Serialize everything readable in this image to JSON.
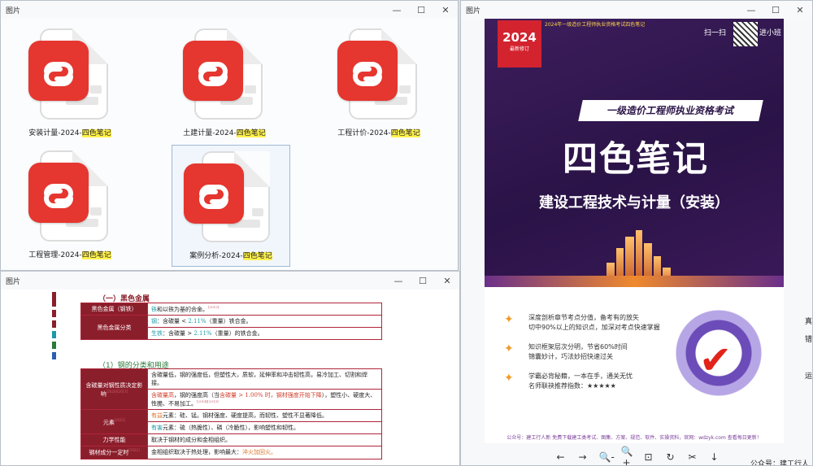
{
  "windows": [
    {
      "title": "图片",
      "controls": [
        "—",
        "☐",
        "✕"
      ]
    },
    {
      "title": "图片",
      "controls": [
        "—",
        "☐",
        "✕"
      ]
    },
    {
      "title": "图片",
      "controls": [
        "—",
        "☐",
        "✕"
      ]
    }
  ],
  "files": [
    {
      "base": "安装计量-2024-",
      "tag": "四色笔记"
    },
    {
      "base": "土建计量-2024-",
      "tag": "四色笔记"
    },
    {
      "base": "工程计价-2024-",
      "tag": "四色笔记"
    },
    {
      "base": "工程管理-2024-",
      "tag": "四色笔记"
    },
    {
      "base": "案例分析-2024-",
      "tag": "四色笔记",
      "selected": true
    }
  ],
  "doc": {
    "sec1": "（一）黑色金属",
    "sec2": "（1）钢的分类和用途",
    "rows": {
      "r1h": "黑色金属（钢铁）",
      "r1a": "铁",
      "r1b": "和以铁为基的合金。",
      "r1s": "[2015]",
      "r2h": "黑色金属分类",
      "r2a1": "钢",
      "r2b1": "：含碳量 < ",
      "r2c1": "2.11%",
      "r2d1": "（重量）铁合金。",
      "r2a2": "生铁",
      "r2b2": "：含碳量 > ",
      "r2c2": "2.11%",
      "r2d2": "（重量）的铁合金。",
      "r3h": "含碳量对钢性质决定影响",
      "r3s": "[2020][2017]",
      "r3a": "含碳量低，钢的强度低，但塑性大，质软，延伸率和冲击韧性高，易冷加工、切割和焊接。",
      "r3b1": "含碳量高",
      "r3b2": "，钢的强度高（当",
      "r3b3": "含碳量 > 1.00% 时，钢材强度开始下降",
      "r3b4": "），塑性小、硬度大、性脆、不易加工。",
      "r3bs": "[2014][2013]",
      "r4h": "元素",
      "r4s": "[2021]",
      "r4a1": "有益",
      "r4a2": "元素：硅、锰。钢材强度、硬度提高，而韧性、塑性不显著降低。",
      "r4b1": "有害",
      "r4b2": "元素：硫（热脆性）、磷（冷脆性），影响塑性和韧性。",
      "r5h": "力学性能",
      "r5a": "取决于钢材的成分和金相组织。",
      "r6h": "钢材成分一定时",
      "r6s": "[2022]",
      "r6a": "金相组织取决于热处理，影响最大：",
      "r6b": "淬火加回火。"
    }
  },
  "cover": {
    "topline": "2024年一级造价工程师执业资格考试四色笔记",
    "year": "2024",
    "edition": "最新修订",
    "scan": "扫一扫",
    "scan2": "进小班",
    "banner": "一级造价工程师执业资格考试",
    "title": "四色笔记",
    "subtitle": "建设工程技术与计量（安装）",
    "f1a": "深度剖析章节考点分值，备考有的放矢",
    "f1b": "切中90%以上的知识点，加深对考点快速掌握",
    "f2a": "知识框架层次分明，节省60%时间",
    "f2b": "锦囊妙计，巧法妙招快速过关",
    "f3a": "学霸必背秘籍，一本在手，通关无忧",
    "f3b": "名师联袂推荐指数：★★★★★",
    "footer": "公众号：建工行人新  免费下载建工类考试、图集、方案、规范、软件、实操资料，官网：wdzyk.com  查看每日更新！"
  },
  "viewer_toolbar": [
    "←",
    "→",
    "🔍-",
    "🔍+",
    "⊡",
    "↻",
    "✂",
    "↓"
  ],
  "corner_label": "公众号：建工行人",
  "side_chars": [
    "真",
    "错",
    "运"
  ],
  "colors": {
    "accent": "#e5362f",
    "highlight": "#fff14d",
    "table_head": "#8b1e2b",
    "cover_purple": "#2a1347"
  }
}
